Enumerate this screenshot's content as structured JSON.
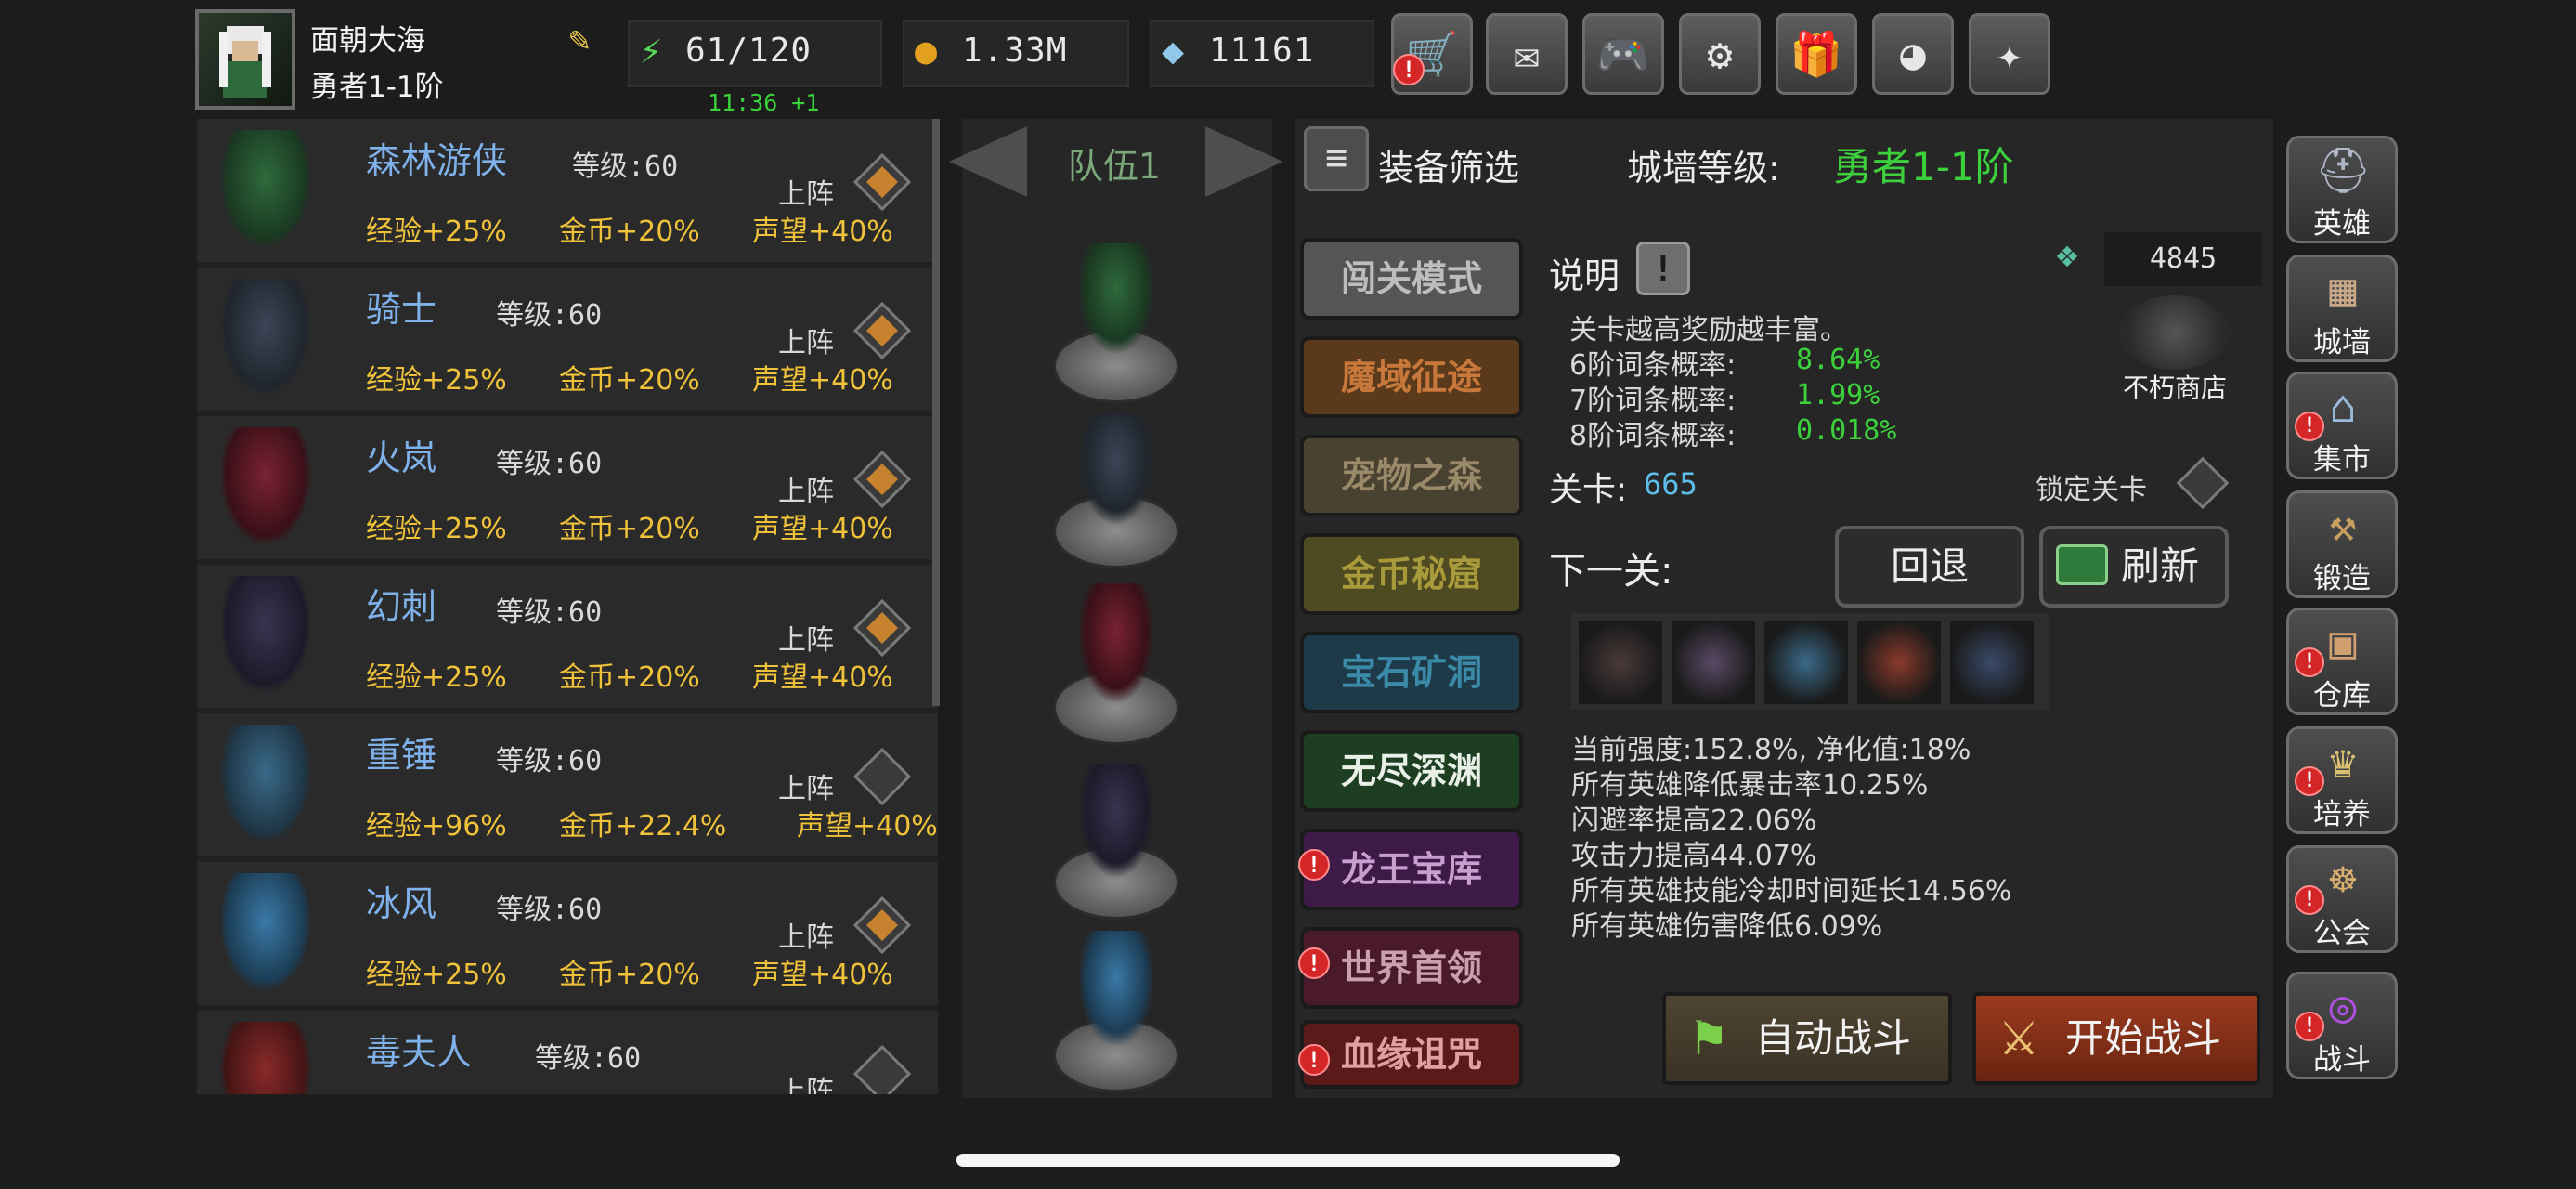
{
  "player": {
    "name": "面朝大海",
    "rank": "勇者1-1阶"
  },
  "resources": {
    "energy": "61/120",
    "energy_timer": "11:36 +1",
    "gold": "1.33M",
    "gems": "11161"
  },
  "top_buttons": [
    "shop-cart-icon",
    "mail-icon",
    "gamepad-icon",
    "settings-gear-icon",
    "gift-icon",
    "color-wheel-icon",
    "fireworks-icon"
  ],
  "heroes": [
    {
      "name": "森林游侠",
      "level": "等级:60",
      "deploy": "上阵",
      "exp": "经验+25%",
      "gold": "金币+20%",
      "rep": "声望+40%",
      "deployed": true,
      "color": "#2f6a3c"
    },
    {
      "name": "骑士",
      "level": "等级:60",
      "deploy": "上阵",
      "exp": "经验+25%",
      "gold": "金币+20%",
      "rep": "声望+40%",
      "deployed": true,
      "color": "#3b4556"
    },
    {
      "name": "火岚",
      "level": "等级:60",
      "deploy": "上阵",
      "exp": "经验+25%",
      "gold": "金币+20%",
      "rep": "声望+40%",
      "deployed": true,
      "color": "#7a2233"
    },
    {
      "name": "幻刺",
      "level": "等级:60",
      "deploy": "上阵",
      "exp": "经验+25%",
      "gold": "金币+20%",
      "rep": "声望+40%",
      "deployed": true,
      "color": "#3a3350"
    },
    {
      "name": "重锤",
      "level": "等级:60",
      "deploy": "上阵",
      "exp": "经验+96%",
      "gold": "金币+22.4%",
      "rep": "声望+40%",
      "deployed": false,
      "color": "#3b6a8a"
    },
    {
      "name": "冰风",
      "level": "等级:60",
      "deploy": "上阵",
      "exp": "经验+25%",
      "gold": "金币+20%",
      "rep": "声望+40%",
      "deployed": true,
      "color": "#3a7aa8"
    },
    {
      "name": "毒夫人",
      "level": "等级:60",
      "deploy": "上阵",
      "deployed": false,
      "color": "#8a2a2a"
    }
  ],
  "team": {
    "label": "队伍1"
  },
  "header": {
    "filter": "装备筛选",
    "wall_level_label": "城墙等级:",
    "wall_level_value": "勇者1-1阶"
  },
  "modes": [
    {
      "label": "闯关模式",
      "bg": "#555555",
      "fg": "#bdbdbd",
      "alert": false
    },
    {
      "label": "魔域征途",
      "bg": "#5a3a1a",
      "fg": "#c8783a",
      "alert": false
    },
    {
      "label": "宠物之森",
      "bg": "#4a4230",
      "fg": "#9a8a6a",
      "alert": false
    },
    {
      "label": "金币秘窟",
      "bg": "#4e4a22",
      "fg": "#a89a3a",
      "alert": false
    },
    {
      "label": "宝石矿洞",
      "bg": "#1e3a48",
      "fg": "#3a8aa8",
      "alert": false
    },
    {
      "label": "无尽深渊",
      "bg": "#1e3e22",
      "fg": "#e8f0e8",
      "alert": false
    },
    {
      "label": "龙王宝库",
      "bg": "#3e1a48",
      "fg": "#c8a0d0",
      "alert": true
    },
    {
      "label": "世界首领",
      "bg": "#4a1a2a",
      "fg": "#c8a0b0",
      "alert": true
    },
    {
      "label": "血缘诅咒",
      "bg": "#5a1a1a",
      "fg": "#e0a0a0",
      "alert": true
    }
  ],
  "description": {
    "label": "说明",
    "text": "关卡越高奖励越丰富。",
    "probabilities": [
      {
        "label": "6阶词条概率:",
        "value": "8.64%"
      },
      {
        "label": "7阶词条概率:",
        "value": "1.99%"
      },
      {
        "label": "8阶词条概率:",
        "value": "0.018%"
      }
    ]
  },
  "currency_box": "4845",
  "shop_label": "不朽商店",
  "stage": {
    "label": "关卡:",
    "value": "665",
    "lock_label": "锁定关卡"
  },
  "next": {
    "label": "下一关:",
    "back": "回退",
    "refresh": "刷新"
  },
  "effects": [
    "当前强度:152.8%, 净化值:18%",
    "所有英雄降低暴击率10.25%",
    "闪避率提高22.06%",
    "攻击力提高44.07%",
    "所有英雄技能冷却时间延长14.56%",
    "所有英雄伤害降低6.09%"
  ],
  "actions": {
    "auto": "自动战斗",
    "start": "开始战斗"
  },
  "side_nav": [
    {
      "label": "英雄",
      "icon": "helmet-icon",
      "alert": false
    },
    {
      "label": "城墙",
      "icon": "wall-icon",
      "alert": false
    },
    {
      "label": "集市",
      "icon": "market-icon",
      "alert": true
    },
    {
      "label": "锻造",
      "icon": "anvil-icon",
      "alert": false
    },
    {
      "label": "仓库",
      "icon": "warehouse-icon",
      "alert": true
    },
    {
      "label": "培养",
      "icon": "chalice-icon",
      "alert": true
    },
    {
      "label": "公会",
      "icon": "guild-icon",
      "alert": true
    },
    {
      "label": "战斗",
      "icon": "portal-icon",
      "alert": true
    }
  ]
}
